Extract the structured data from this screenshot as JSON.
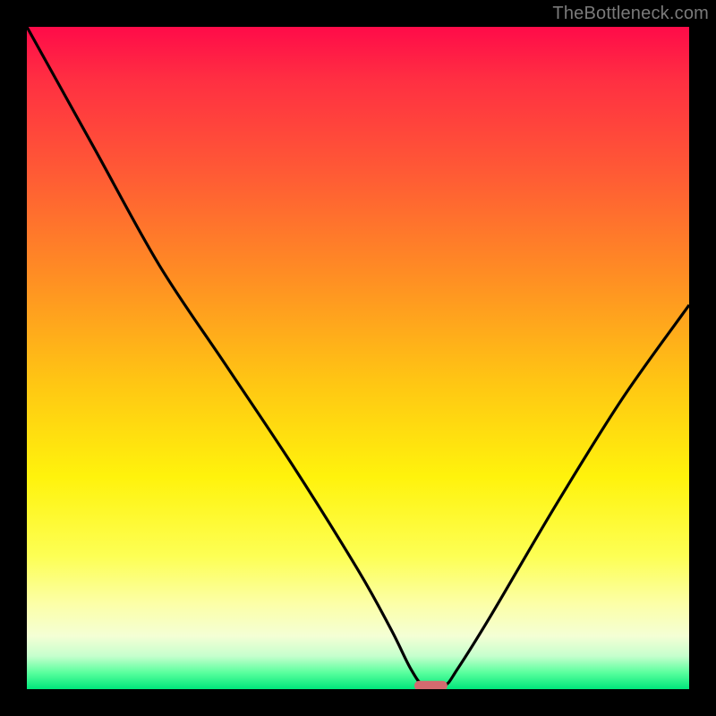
{
  "watermark": "TheBottleneck.com",
  "colors": {
    "frame": "#000000",
    "gradient_stops": [
      {
        "pct": 0,
        "hex": "#ff0b49"
      },
      {
        "pct": 8,
        "hex": "#ff2f42"
      },
      {
        "pct": 22,
        "hex": "#ff5a35"
      },
      {
        "pct": 38,
        "hex": "#ff8f23"
      },
      {
        "pct": 54,
        "hex": "#ffc713"
      },
      {
        "pct": 68,
        "hex": "#fff30c"
      },
      {
        "pct": 80,
        "hex": "#fdff55"
      },
      {
        "pct": 87,
        "hex": "#fcffa6"
      },
      {
        "pct": 92,
        "hex": "#f4ffd5"
      },
      {
        "pct": 95,
        "hex": "#c6ffcd"
      },
      {
        "pct": 97.5,
        "hex": "#5aff9e"
      },
      {
        "pct": 100,
        "hex": "#00e67a"
      }
    ],
    "curve": "#000000",
    "marker": "#d36a6f"
  },
  "chart_data": {
    "type": "line",
    "title": "",
    "xlabel": "",
    "ylabel": "",
    "xlim": [
      0,
      100
    ],
    "ylim": [
      0,
      100
    ],
    "series": [
      {
        "name": "bottleneck-curve",
        "x": [
          0,
          10,
          20,
          30,
          40,
          50,
          55,
          58,
          60,
          63,
          65,
          70,
          80,
          90,
          100
        ],
        "y": [
          100,
          82,
          64,
          49,
          34,
          18,
          9,
          3,
          0.5,
          0.5,
          3,
          11,
          28,
          44,
          58
        ]
      }
    ],
    "annotations": [
      {
        "name": "optimal-marker",
        "shape": "pill",
        "x_range": [
          58.5,
          63.5
        ],
        "y": 0.5,
        "color": "#d36a6f"
      }
    ],
    "watermark": "TheBottleneck.com",
    "grid": false
  }
}
